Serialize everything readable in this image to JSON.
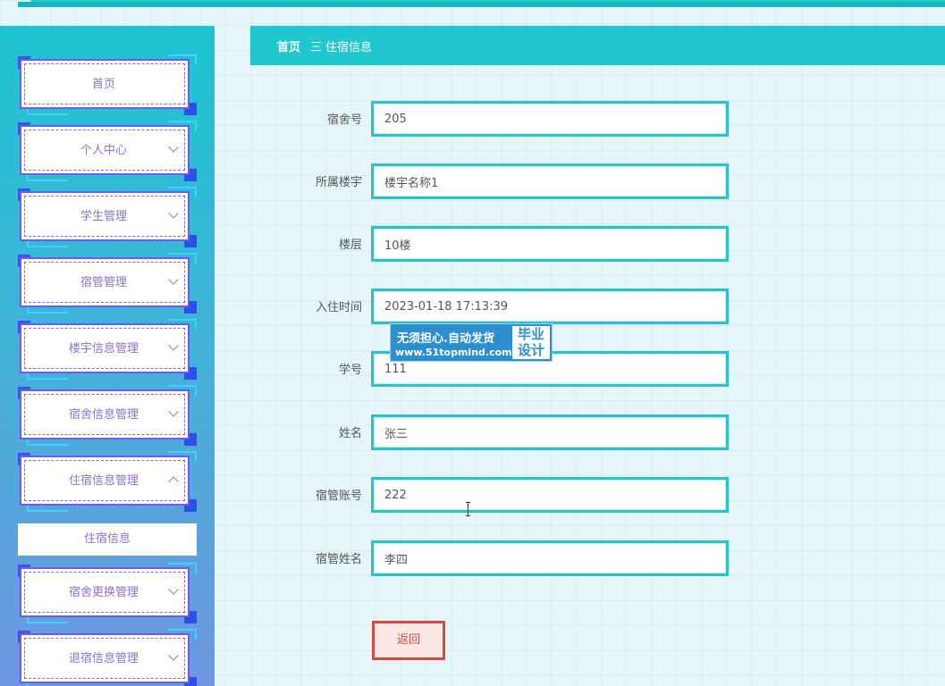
{
  "sidebar": {
    "items": [
      {
        "label": "首页",
        "has_chevron": false
      },
      {
        "label": "个人中心",
        "has_chevron": true
      },
      {
        "label": "学生管理",
        "has_chevron": true
      },
      {
        "label": "宿管管理",
        "has_chevron": true
      },
      {
        "label": "楼宇信息管理",
        "has_chevron": true
      },
      {
        "label": "宿舍信息管理",
        "has_chevron": true
      },
      {
        "label": "住宿信息管理",
        "has_chevron": true,
        "expanded": true
      },
      {
        "label": "宿舍更换管理",
        "has_chevron": true
      },
      {
        "label": "退宿信息管理",
        "has_chevron": true
      }
    ],
    "submenu": {
      "label": "住宿信息"
    }
  },
  "breadcrumb": {
    "home": "首页",
    "separator": "三",
    "current": "住宿信息"
  },
  "form": {
    "fields": [
      {
        "label": "宿舍号",
        "value": "205"
      },
      {
        "label": "所属楼宇",
        "value": "楼宇名称1"
      },
      {
        "label": "楼层",
        "value": "10楼"
      },
      {
        "label": "入住时间",
        "value": "2023-01-18 17:13:39"
      },
      {
        "label": "学号",
        "value": "111"
      },
      {
        "label": "姓名",
        "value": "张三"
      },
      {
        "label": "宿管账号",
        "value": "222"
      },
      {
        "label": "宿管姓名",
        "value": "李四"
      }
    ],
    "back_label": "返回"
  },
  "watermark": {
    "line1": "无须担心.自动发货",
    "line2": "www.51topmind.com",
    "right1": "毕业",
    "right2": "设计"
  },
  "colors": {
    "accent": "#1fc7cf",
    "menu_border": "#6a5cf0",
    "danger": "#d5493e"
  }
}
